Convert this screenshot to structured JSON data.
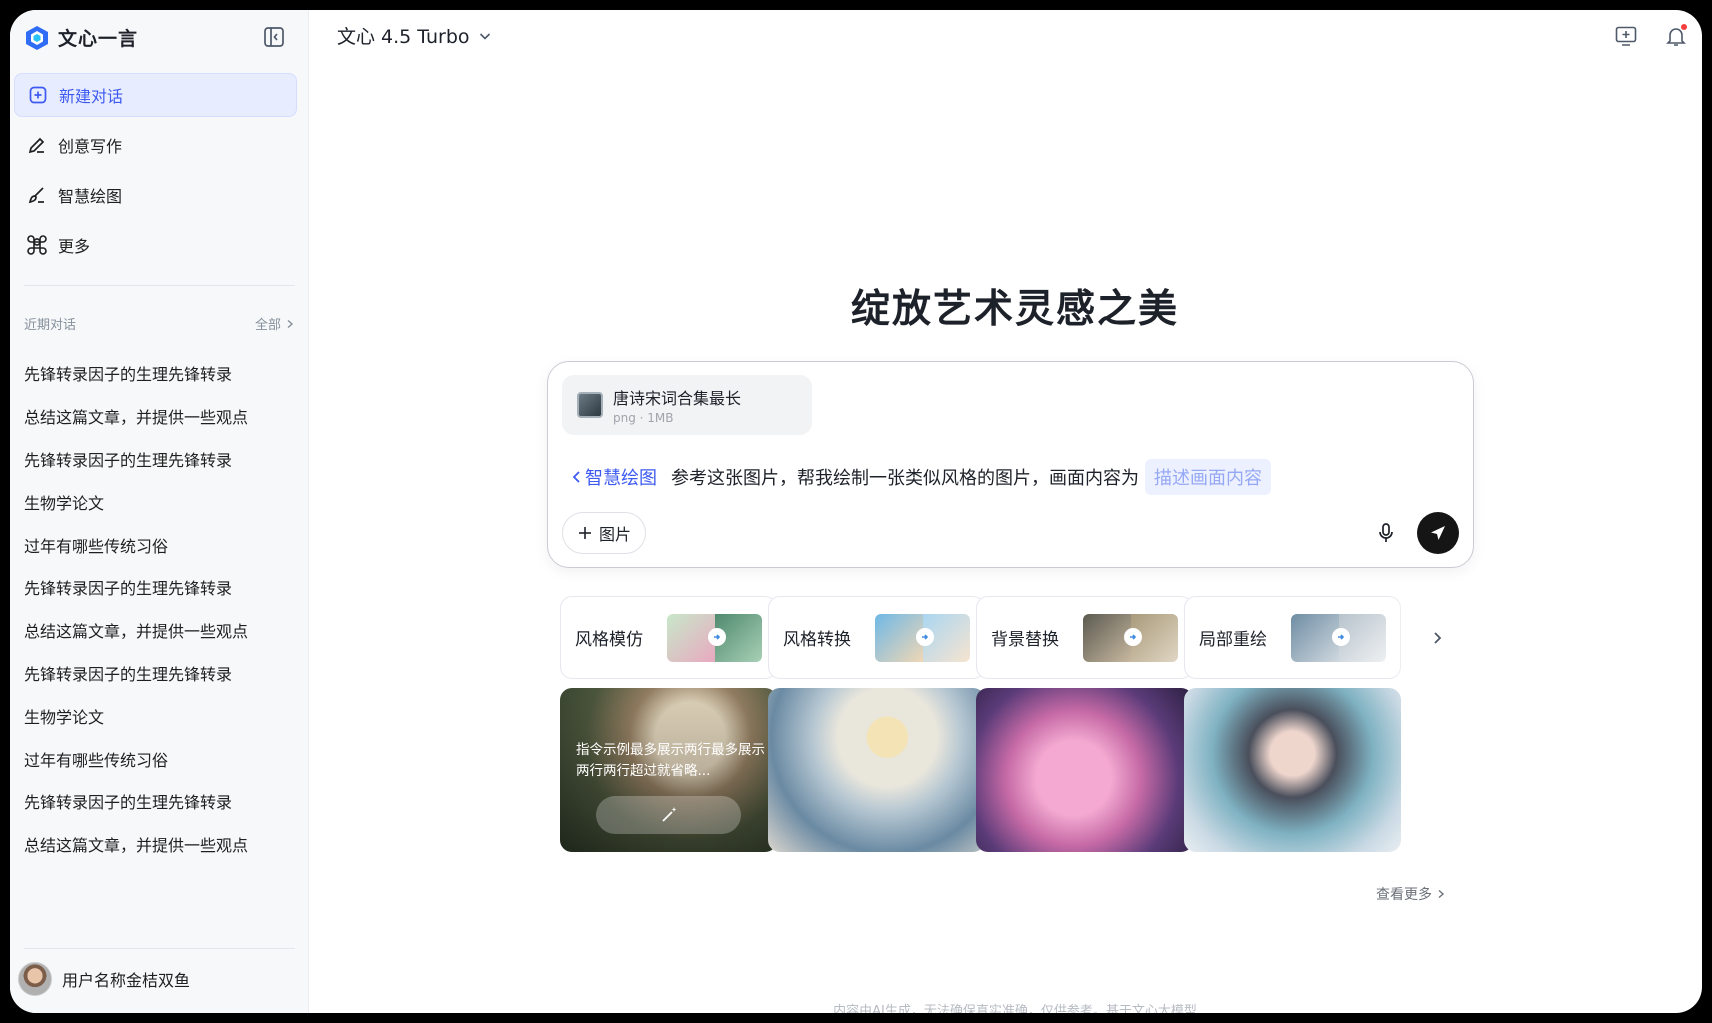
{
  "app": {
    "name": "文心一言",
    "model": "文心 4.5 Turbo"
  },
  "nav": [
    {
      "label": "新建对话",
      "icon": "new-chat-icon"
    },
    {
      "label": "创意写作",
      "icon": "pen-icon"
    },
    {
      "label": "智慧绘图",
      "icon": "paint-brush-icon"
    },
    {
      "label": "更多",
      "icon": "command-icon"
    }
  ],
  "recent": {
    "title": "近期对话",
    "all_label": "全部",
    "items": [
      "先锋转录因子的生理先锋转录",
      "总结这篇文章，并提供一些观点",
      "先锋转录因子的生理先锋转录",
      "生物学论文",
      "过年有哪些传统习俗",
      "先锋转录因子的生理先锋转录",
      "总结这篇文章，并提供一些观点",
      "先锋转录因子的生理先锋转录",
      "生物学论文",
      "过年有哪些传统习俗",
      "先锋转录因子的生理先锋转录",
      "总结这篇文章，并提供一些观点"
    ]
  },
  "user": {
    "name": "用户名称金桔双鱼"
  },
  "hero": {
    "title": "绽放艺术灵感之美"
  },
  "composer": {
    "file": {
      "name": "唐诗宋词合集最长",
      "meta": "png · 1MB"
    },
    "mode": "智慧绘图",
    "prompt": "参考这张图片，帮我绘制一张类似风格的图片，画面内容为",
    "slot_placeholder": "描述画面内容",
    "add_image_label": "图片"
  },
  "tools": [
    {
      "label": "风格模仿",
      "colors": [
        "#8fd0b0",
        "#5a9a78"
      ]
    },
    {
      "label": "风格转换",
      "colors": [
        "#7cc0e8",
        "#b9dff3"
      ]
    },
    {
      "label": "背景替换",
      "colors": [
        "#6c6a5a",
        "#a89a80"
      ]
    },
    {
      "label": "局部重绘",
      "colors": [
        "#8fa4b4",
        "#d9dde2"
      ]
    }
  ],
  "gallery": {
    "first_caption": "指令示例最多展示两行最多展示两行两行超过就省略...",
    "more_label": "查看更多"
  },
  "footer": {
    "note": "内容由AI生成，无法确保真实准确，仅供参考。基于文心大模型"
  },
  "colors": {
    "accent": "#3d5af1",
    "send": "#151515"
  }
}
